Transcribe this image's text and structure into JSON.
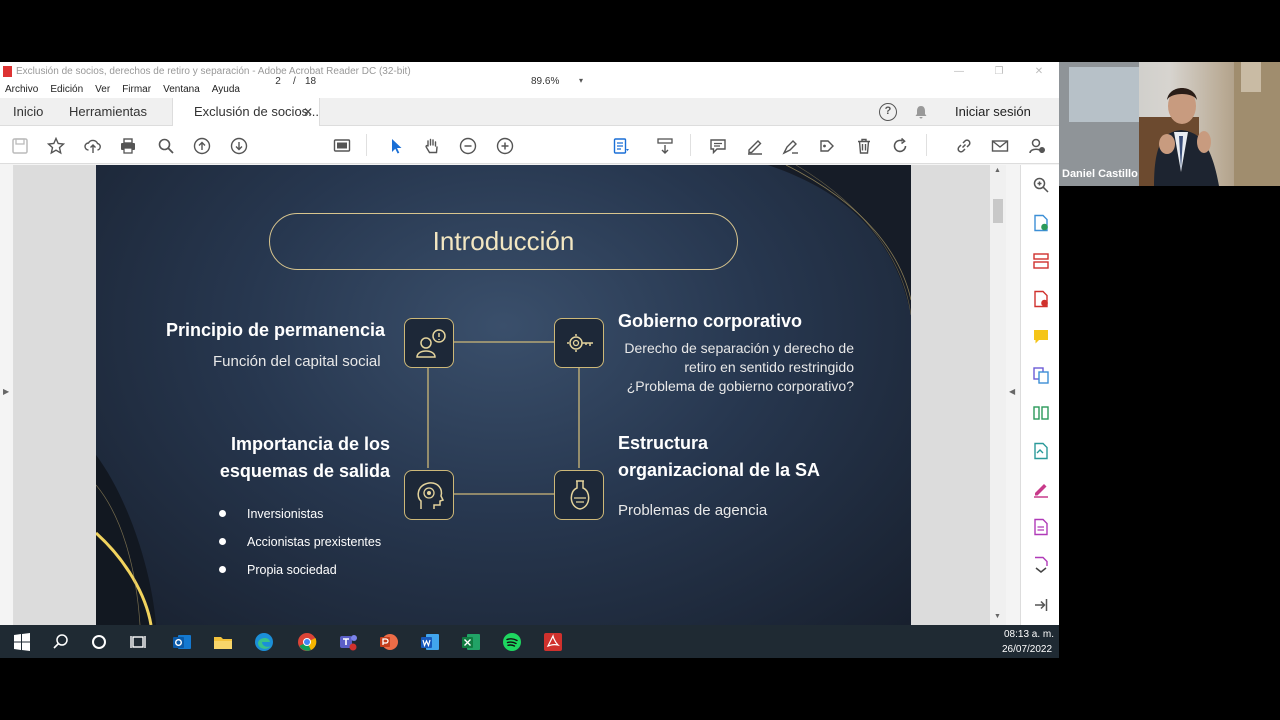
{
  "window": {
    "title": "Exclusión de socios, derechos de retiro y separación - Adobe Acrobat Reader DC (32-bit)",
    "controls": [
      "—",
      "❐",
      "✕"
    ]
  },
  "menu": [
    "Archivo",
    "Edición",
    "Ver",
    "Firmar",
    "Ventana",
    "Ayuda"
  ],
  "tabs": {
    "home": "Inicio",
    "tools": "Herramientas",
    "doc": "Exclusión de socios...",
    "close": "✕"
  },
  "header": {
    "signin": "Iniciar sesión",
    "help": "?"
  },
  "toolbar": {
    "page_current": "2",
    "page_sep": "/",
    "page_total": "18",
    "zoom": "89.6%",
    "zoom_arrow": "▾"
  },
  "slide": {
    "title": "Introducción",
    "top_left": {
      "heading": "Principio de permanencia",
      "sub": "Función del capital social"
    },
    "top_right": {
      "heading": "Gobierno corporativo",
      "line1": "Derecho de separación y derecho de",
      "line2": "retiro en sentido restringido",
      "line3": "¿Problema de gobierno corporativo?"
    },
    "bottom_left": {
      "heading1": "Importancia de los",
      "heading2": "esquemas de salida",
      "bullets": [
        "Inversionistas",
        "Accionistas prexistentes",
        "Propia sociedad"
      ]
    },
    "bottom_right": {
      "heading1": "Estructura",
      "heading2": "organizacional de la SA",
      "sub": "Problemas de agencia"
    }
  },
  "webcam": {
    "name": "Daniel Castillo"
  },
  "taskbar": {
    "time": "08:13 a. m.",
    "date": "26/07/2022"
  },
  "colors": {
    "accent_gold": "#d8c58e",
    "acrobat_red": "#d0312d",
    "slide_bg": "#27374f"
  },
  "icons": {
    "toolbar": [
      "save-icon",
      "star-icon",
      "upload-icon",
      "print-icon",
      "search-icon",
      "page-up-icon",
      "page-down-icon",
      "fit-page-icon",
      "select-pointer-icon",
      "hand-icon",
      "zoom-out-icon",
      "zoom-in-icon",
      "page-layout-icon",
      "scroll-mode-icon",
      "comment-icon",
      "highlight-pen-icon",
      "sign-icon",
      "stamp-icon",
      "delete-icon",
      "rotate-icon",
      "link-icon",
      "mail-icon",
      "add-user-icon"
    ],
    "right_panel": [
      "zoom-icon",
      "create-pdf-icon",
      "organize-icon",
      "export-pdf-icon",
      "comment-icon",
      "combine-icon",
      "compress-icon",
      "convert-icon",
      "fill-sign-icon",
      "edit-pdf-icon",
      "more-tools-icon",
      "expand-icon"
    ],
    "taskbar": [
      "windows-start-icon",
      "search-icon",
      "cortana-icon",
      "task-view-icon",
      "outlook-icon",
      "file-explorer-icon",
      "edge-icon",
      "chrome-icon",
      "teams-icon",
      "powerpoint-icon",
      "word-icon",
      "excel-icon",
      "spotify-icon",
      "acrobat-icon"
    ]
  }
}
